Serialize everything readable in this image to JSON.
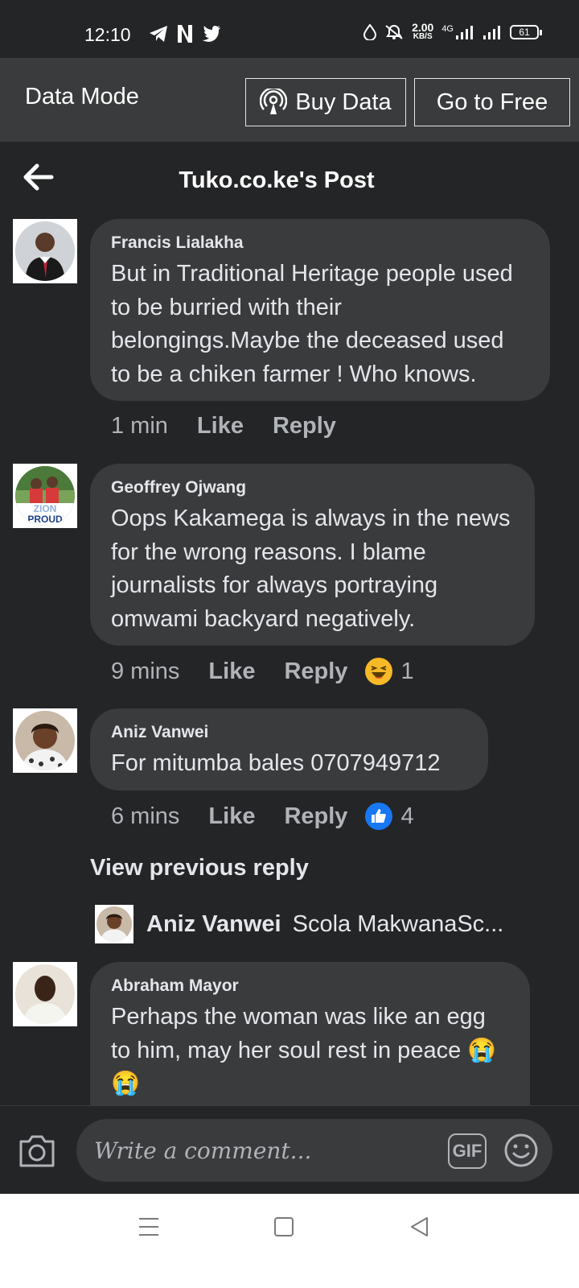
{
  "status_bar": {
    "time": "12:10",
    "speed_value": "2.00",
    "speed_unit": "KB/S",
    "network": "4G",
    "battery": "61"
  },
  "data_mode": {
    "title": "Data Mode",
    "buy_label": "Buy Data",
    "free_label": "Go to Free"
  },
  "header": {
    "title": "Tuko.co.ke's Post"
  },
  "comments": [
    {
      "author": "Francis Lialakha",
      "text": "But in Traditional Heritage people used to be burried with their belongings.Maybe the deceased used to be a chiken farmer ! Who knows.",
      "time": "1 min",
      "like": "Like",
      "reply": "Reply"
    },
    {
      "author": "Geoffrey Ojwang",
      "text": "Oops Kakamega is always in the news for the wrong reasons. I blame journalists for always portraying omwami backyard negatively.",
      "time": "9 mins",
      "like": "Like",
      "reply": "Reply",
      "reaction": "haha",
      "reaction_count": "1"
    },
    {
      "author": "Aniz Vanwei",
      "text": "For mitumba bales 0707949712",
      "time": "6 mins",
      "like": "Like",
      "reply": "Reply",
      "reaction": "like",
      "reaction_count": "4"
    },
    {
      "author": "Abraham Mayor",
      "text": "Perhaps the woman was like an egg to him, may her soul rest in peace 😭😭"
    }
  ],
  "view_previous": "View previous reply",
  "reply_preview": {
    "author": "Aniz Vanwei",
    "text": "Scola MakwanaSc..."
  },
  "avatar_badge": {
    "line1": "ZION",
    "line2": "PROUD"
  },
  "composer": {
    "placeholder": "Write a comment...",
    "gif_label": "GIF"
  },
  "colors": {
    "background": "#242526",
    "bubble": "#3a3b3c",
    "secondary_text": "#b0b3b8",
    "like_blue": "#1877f2",
    "haha_yellow": "#f7b928"
  }
}
